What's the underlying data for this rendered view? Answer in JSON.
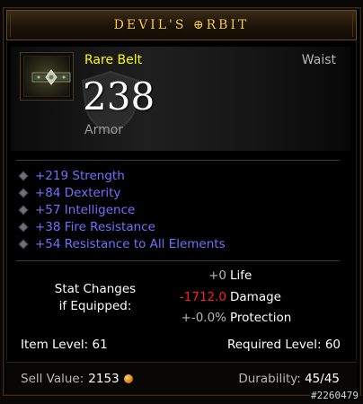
{
  "item": {
    "name": "DEVIL'S ⊕RBIT",
    "quality_type": "Rare Belt",
    "slot": "Waist",
    "armor_value": "238",
    "armor_label": "Armor"
  },
  "affixes": [
    "+219 Strength",
    "+84 Dexterity",
    "+57 Intelligence",
    "+38 Fire Resistance",
    "+54 Resistance to All Elements"
  ],
  "stat_changes": {
    "label_line1": "Stat Changes",
    "label_line2": "if Equipped:",
    "rows": [
      {
        "value": "+0",
        "name": "Life",
        "color": "#b7b7b7"
      },
      {
        "value": "-1712.0",
        "name": "Damage",
        "color": "#ff1e1e"
      },
      {
        "value": "+-0.0%",
        "name": "Protection",
        "color": "#b7b7b7"
      }
    ]
  },
  "levels": {
    "item_level": "Item Level: 61",
    "required_level": "Required Level: 60"
  },
  "footer": {
    "sell_label": "Sell Value:",
    "sell_value": "2153",
    "durability_label": "Durability:",
    "durability_value": "45/45"
  },
  "watermark": "#2260479",
  "colors": {
    "title": "#ffcf3a",
    "rare": "#ffff00",
    "affix": "#7171ff",
    "negative": "#ff1e1e"
  },
  "icons": {
    "item": "belt-icon",
    "bullet": "diamond-bullet-icon",
    "currency": "gold-coin-icon",
    "armor_backdrop": "shield-icon"
  }
}
